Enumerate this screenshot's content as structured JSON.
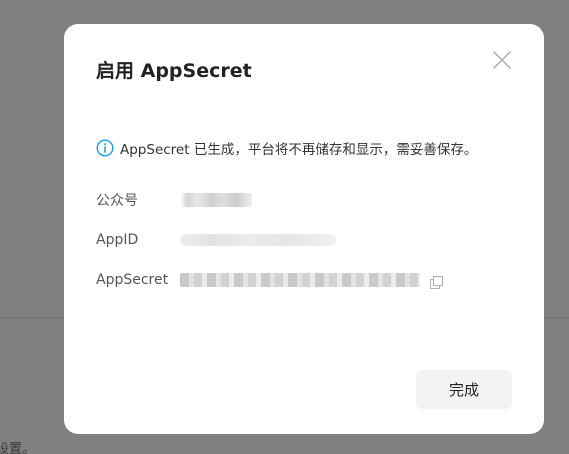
{
  "background": {
    "bottom_text": "设置。"
  },
  "dialog": {
    "title": "启用 AppSecret",
    "close_icon": "close-icon",
    "notice": {
      "icon": "info-circle-icon",
      "icon_color": "#1e9fe0",
      "text": "AppSecret 已生成，平台将不再储存和显示，需妥善保存。"
    },
    "fields": [
      {
        "label": "公众号",
        "value": ""
      },
      {
        "label": "AppID",
        "value": ""
      },
      {
        "label": "AppSecret",
        "value": ""
      }
    ],
    "copy_icon": "copy-icon",
    "done_label": "完成"
  }
}
